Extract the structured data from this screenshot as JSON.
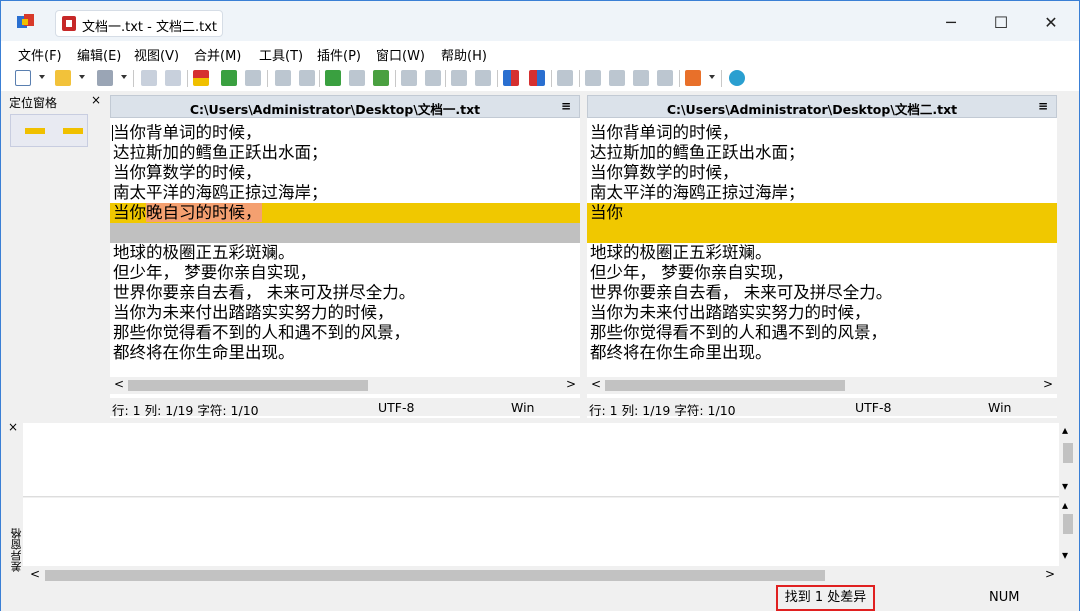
{
  "window": {
    "title": "文档一.txt - 文档二.txt",
    "minimize": "─",
    "maximize": "☐",
    "close": "✕"
  },
  "menu": [
    "文件(F)",
    "编辑(E)",
    "视图(V)",
    "合并(M)",
    "工具(T)",
    "插件(P)",
    "窗口(W)",
    "帮助(H)"
  ],
  "location_pane": {
    "title": "定位窗格",
    "close": "×"
  },
  "left": {
    "path": "C:\\Users\\Administrator\\Desktop\\文档一.txt",
    "menu_icon": "≡",
    "lines": [
      "当你背单词的时候，",
      "达拉斯加的鳕鱼正跃出水面；",
      "当你算数学的时候，",
      "南太平洋的海鸥正掠过海岸；"
    ],
    "diff_line_prefix": "当你",
    "diff_line_highlight": "晚自习的时候，",
    "lines_after": [
      "地球的极圈正五彩斑斓。",
      "但少年， 梦要你亲自实现，",
      "世界你要亲自去看， 未来可及拼尽全力。",
      "当你为未来付出踏踏实实努力的时候，",
      "那些你觉得看不到的人和遇不到的风景，",
      "都终将在你生命里出现。"
    ],
    "status": {
      "pos": "行: 1  列: 1/19  字符: 1/10",
      "encoding": "UTF-8",
      "eol": "Win"
    }
  },
  "right": {
    "path": "C:\\Users\\Administrator\\Desktop\\文档二.txt",
    "menu_icon": "≡",
    "lines": [
      "当你背单词的时候，",
      "达拉斯加的鳕鱼正跃出水面；",
      "当你算数学的时候，",
      "南太平洋的海鸥正掠过海岸；"
    ],
    "diff_line": "当你",
    "lines_after": [
      "地球的极圈正五彩斑斓。",
      "但少年， 梦要你亲自实现，",
      "世界你要亲自去看， 未来可及拼尽全力。",
      "当你为未来付出踏踏实实努力的时候，",
      "那些你觉得看不到的人和遇不到的风景，",
      "都终将在你生命里出现。"
    ],
    "status": {
      "pos": "行: 1  列: 1/19  字符: 1/10",
      "encoding": "UTF-8",
      "eol": "Win"
    }
  },
  "diff_pane": {
    "label": "差异窗格",
    "close": "×"
  },
  "statusbar": {
    "found": "找到 1 处差异",
    "num": "NUM"
  },
  "colors": {
    "diff": "#f0c800",
    "inline": "#f4a070",
    "gap": "#c0c0c0"
  }
}
